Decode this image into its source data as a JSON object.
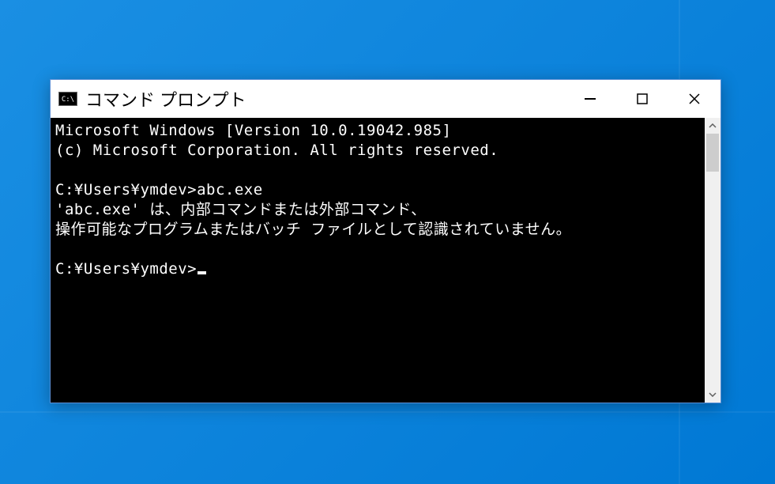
{
  "window": {
    "title": "コマンド プロンプト",
    "icon_label": "C:\\"
  },
  "terminal": {
    "line1": "Microsoft Windows [Version 10.0.19042.985]",
    "line2": "(c) Microsoft Corporation. All rights reserved.",
    "blank1": "",
    "prompt1": "C:¥Users¥ymdev>abc.exe",
    "error1": "'abc.exe' は、内部コマンドまたは外部コマンド、",
    "error2": "操作可能なプログラムまたはバッチ ファイルとして認識されていません。",
    "blank2": "",
    "prompt2": "C:¥Users¥ymdev>"
  }
}
